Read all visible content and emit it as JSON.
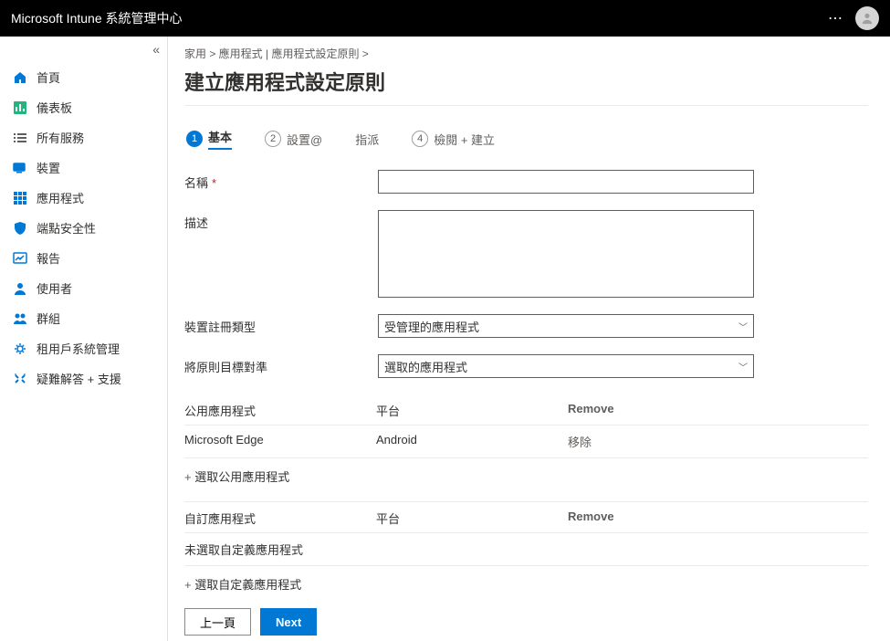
{
  "header": {
    "title": "Microsoft Intune 系統管理中心"
  },
  "sidebar": {
    "items": [
      {
        "label": "首頁",
        "icon": "home-icon"
      },
      {
        "label": "儀表板",
        "icon": "dashboard-icon"
      },
      {
        "label": "所有服務",
        "icon": "list-icon"
      },
      {
        "label": "裝置",
        "icon": "devices-icon"
      },
      {
        "label": "應用程式",
        "icon": "apps-icon"
      },
      {
        "label": "端點安全性",
        "icon": "shield-icon"
      },
      {
        "label": "報告",
        "icon": "report-icon"
      },
      {
        "label": "使用者",
        "icon": "user-icon"
      },
      {
        "label": "群組",
        "icon": "group-icon"
      },
      {
        "label": "租用戶系統管理",
        "icon": "tenant-icon"
      },
      {
        "label": "疑難解答 + 支援",
        "icon": "support-icon"
      }
    ]
  },
  "breadcrumb": "家用 &gt;  應用程式 | 應用程式設定原則 &gt;",
  "page_title": "建立應用程式設定原則",
  "steps": [
    {
      "num": "1",
      "label": "基本"
    },
    {
      "num": "2",
      "label": "設置@"
    },
    {
      "num": "",
      "label": "指派"
    },
    {
      "num": "4",
      "label": "檢閱 + 建立"
    }
  ],
  "form": {
    "name_label": "名稱",
    "name_value": "",
    "desc_label": "描述",
    "desc_value": "",
    "enroll_label": "裝置註冊類型",
    "enroll_value": "受管理的應用程式",
    "target_label": "將原則目標對準",
    "target_value": "選取的應用程式"
  },
  "public_apps": {
    "header_a": "公用應用程式",
    "header_b": "平台",
    "header_c": "Remove",
    "rows": [
      {
        "a": "Microsoft Edge",
        "b": "Android",
        "c": "移除"
      }
    ],
    "add_link": "選取公用應用程式"
  },
  "custom_apps": {
    "header_a": "自訂應用程式",
    "header_b": "平台",
    "header_c": "Remove",
    "empty_text": "未選取自定義應用程式",
    "add_link": "選取自定義應用程式"
  },
  "buttons": {
    "prev": "上一頁",
    "next": "Next"
  }
}
